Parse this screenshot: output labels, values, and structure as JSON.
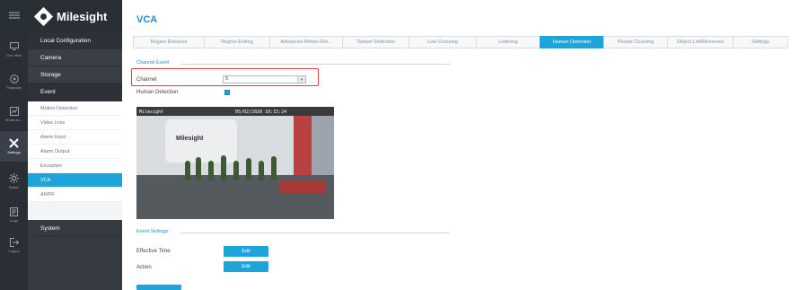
{
  "app": {
    "brand": "Milesight"
  },
  "rail": [
    {
      "name": "menu-icon",
      "label": ""
    },
    {
      "name": "live-view-icon",
      "label": "Live View"
    },
    {
      "name": "playback-icon",
      "label": "Playback"
    },
    {
      "name": "smart-analysis-icon",
      "label": "Smart An..."
    },
    {
      "name": "settings-icon",
      "label": "Settings"
    },
    {
      "name": "status-icon",
      "label": "Status"
    },
    {
      "name": "logs-icon",
      "label": "Logs"
    },
    {
      "name": "logout-icon",
      "label": "Logout"
    }
  ],
  "menu": {
    "local_configuration": "Local Configuration",
    "camera": "Camera",
    "storage": "Storage",
    "event": "Event",
    "event_items": [
      "Motion Detection",
      "Video Loss",
      "Alarm Input",
      "Alarm Output",
      "Exception",
      "VCA",
      "ANPR"
    ],
    "system": "System"
  },
  "page": {
    "title": "VCA",
    "tabs": [
      "Region Entrance",
      "Region Exiting",
      "Advanced Motion Det...",
      "Tamper Detection",
      "Line Crossing",
      "Loitering",
      "Human Detection",
      "People Counting",
      "Object Left/Removed",
      "Settings"
    ],
    "active_tab": "Human Detection"
  },
  "channel_event": {
    "section_title": "Channel Event",
    "channel_label": "Channel",
    "channel_value": "5",
    "human_detection_label": "Human Detection",
    "human_detection_checked": true
  },
  "video": {
    "osd_left": "Milesight",
    "osd_datetime": "05/02/2020 10:15:24",
    "wall_logo": "Milesight"
  },
  "event_settings": {
    "section_title": "Event Settings",
    "effective_time_label": "Effective Time",
    "action_label": "Action",
    "edit_label": "Edit"
  },
  "colors": {
    "accent": "#1ea4d8",
    "title": "#1e8fc7",
    "sidebar_dark": "#2a2f36",
    "highlight": "#e03a3a"
  }
}
